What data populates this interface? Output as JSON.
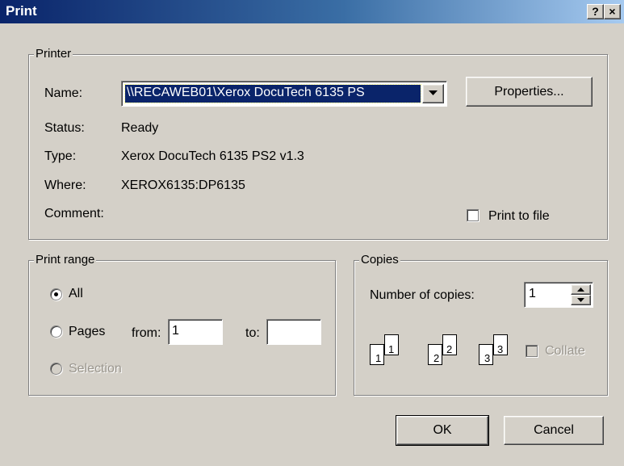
{
  "window": {
    "title": "Print",
    "help_button": "?",
    "close_button": "×"
  },
  "printer": {
    "legend": "Printer",
    "name_label": "Name:",
    "name_value": "\\\\RECAWEB01\\Xerox DocuTech 6135 PS",
    "properties_button": "Properties...",
    "status_label": "Status:",
    "status_value": "Ready",
    "type_label": "Type:",
    "type_value": "Xerox DocuTech 6135 PS2 v1.3",
    "where_label": "Where:",
    "where_value": "XEROX6135:DP6135",
    "comment_label": "Comment:",
    "comment_value": "",
    "print_to_file_label": "Print to file",
    "print_to_file_checked": false
  },
  "print_range": {
    "legend": "Print range",
    "all_label": "All",
    "pages_label": "Pages",
    "from_label": "from:",
    "from_value": "1",
    "to_label": "to:",
    "to_value": "",
    "selection_label": "Selection",
    "selected": "All"
  },
  "copies": {
    "legend": "Copies",
    "number_label": "Number of copies:",
    "number_value": "1",
    "collate_label": "Collate",
    "collate_checked": false,
    "collate_enabled": false,
    "icon_pages": [
      {
        "front": "1",
        "back": "1"
      },
      {
        "front": "2",
        "back": "2"
      },
      {
        "front": "3",
        "back": "3"
      }
    ]
  },
  "buttons": {
    "ok": "OK",
    "cancel": "Cancel"
  },
  "colors": {
    "title_gradient_start": "#0a246a",
    "title_gradient_end": "#a6caf0",
    "dialog_face": "#d4d0c8",
    "selection_highlight": "#0a246a"
  }
}
